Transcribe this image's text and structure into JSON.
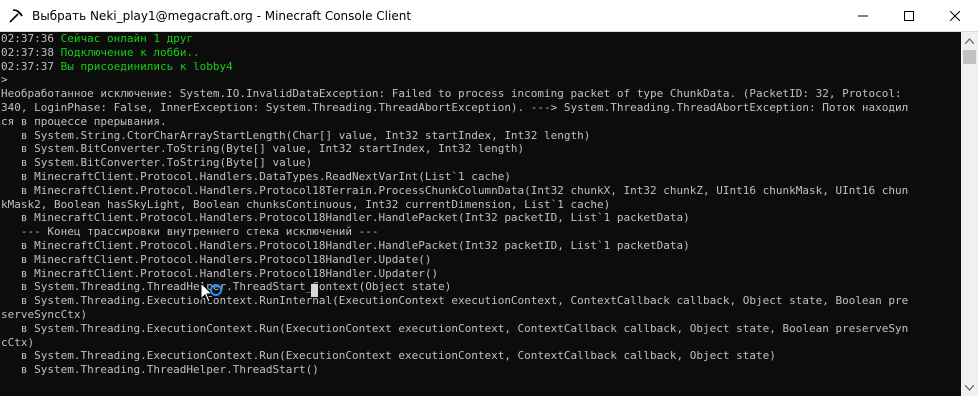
{
  "window": {
    "title": "Выбрать Neki_play1@megacraft.org - Minecraft Console Client",
    "icon": "pickaxe-icon",
    "controls": [
      "minimize-icon",
      "maximize-icon",
      "close-icon"
    ]
  },
  "console": {
    "log": [
      {
        "time": "02:37:36",
        "text": " Сейчас онлайн 1 друг"
      },
      {
        "time": "02:37:38",
        "text": " Подключение к лобби.."
      },
      {
        "time": "02:37:37",
        "text": " Вы присоединились к lobby4"
      }
    ],
    "lines": [
      ">",
      "Необработанное исключение: System.IO.InvalidDataException: Failed to process incoming packet of type ChunkData. (PacketID: 32, Protocol:",
      "340, LoginPhase: False, InnerException: System.Threading.ThreadAbortException). ---> System.Threading.ThreadAbortException: Поток находил",
      "ся в процессе прерывания.",
      "   в System.String.CtorCharArrayStartLength(Char[] value, Int32 startIndex, Int32 length)",
      "   в System.BitConverter.ToString(Byte[] value, Int32 startIndex, Int32 length)",
      "   в System.BitConverter.ToString(Byte[] value)",
      "   в MinecraftClient.Protocol.Handlers.DataTypes.ReadNextVarInt(List`1 cache)",
      "   в MinecraftClient.Protocol.Handlers.Protocol18Terrain.ProcessChunkColumnData(Int32 chunkX, Int32 chunkZ, UInt16 chunkMask, UInt16 chun",
      "kMask2, Boolean hasSkyLight, Boolean chunksContinuous, Int32 currentDimension, List`1 cache)",
      "   в MinecraftClient.Protocol.Handlers.Protocol18Handler.HandlePacket(Int32 packetID, List`1 packetData)",
      "   --- Конец трассировки внутреннего стека исключений ---",
      "   в MinecraftClient.Protocol.Handlers.Protocol18Handler.HandlePacket(Int32 packetID, List`1 packetData)",
      "   в MinecraftClient.Protocol.Handlers.Protocol18Handler.Update()",
      "   в MinecraftClient.Protocol.Handlers.Protocol18Handler.Updater()",
      "   в System.Threading.ThreadHelper.ThreadStart_Context(Object state)",
      "   в System.Threading.ExecutionContext.RunInternal(ExecutionContext executionContext, ContextCallback callback, Object state, Boolean pre",
      "serveSyncCtx)",
      "   в System.Threading.ExecutionContext.Run(ExecutionContext executionContext, ContextCallback callback, Object state, Boolean preserveSyn",
      "cCtx)",
      "   в System.Threading.ExecutionContext.Run(ExecutionContext executionContext, ContextCallback callback, Object state)",
      "   в System.Threading.ThreadHelper.ThreadStart()"
    ]
  },
  "colors": {
    "console_bg": "#0c0c0c",
    "console_text": "#c0c0c0",
    "log_message": "#13d013"
  }
}
